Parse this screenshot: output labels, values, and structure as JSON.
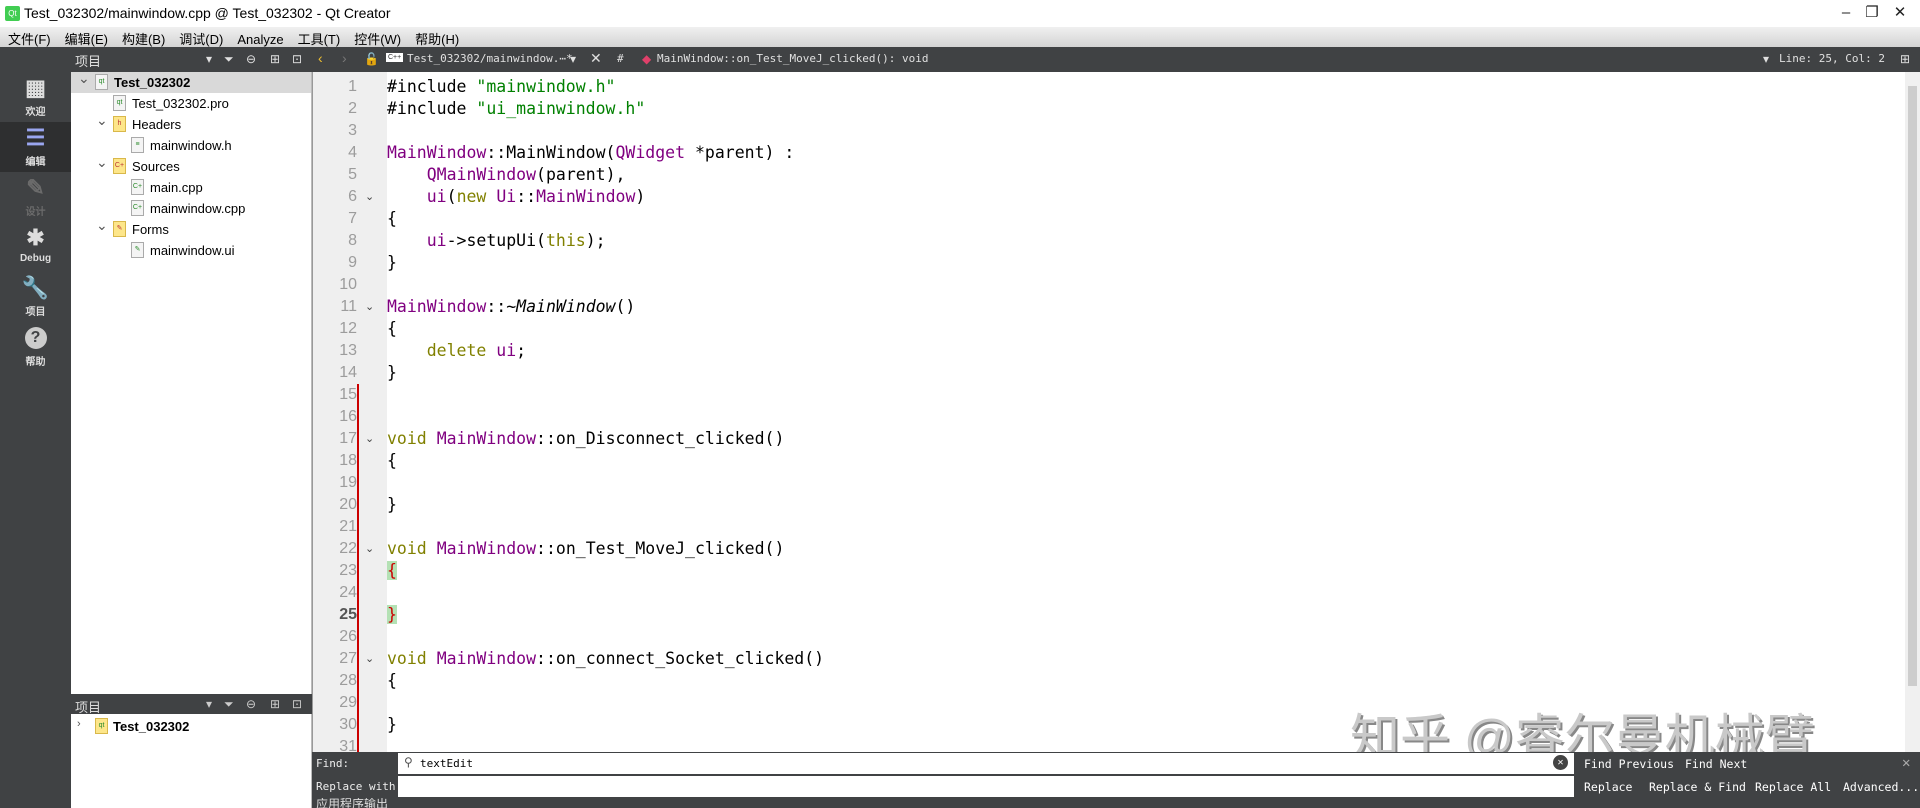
{
  "window": {
    "title": "Test_032302/mainwindow.cpp @ Test_032302 - Qt Creator",
    "app_icon": "Qt",
    "minimize": "–",
    "restore": "❐",
    "close": "✕"
  },
  "menu": [
    "文件(F)",
    "编辑(E)",
    "构建(B)",
    "调试(D)",
    "Analyze",
    "工具(T)",
    "控件(W)",
    "帮助(H)"
  ],
  "toolbar": {
    "panel_title": "项目",
    "file_tab": "Test_032302/mainwindow.⋯*",
    "symbol": "#",
    "function": "MainWindow::on_Test_MoveJ_clicked(): void",
    "position": "Line: 25, Col: 2"
  },
  "modes": [
    {
      "label": "欢迎",
      "icon": "grid-icon"
    },
    {
      "label": "编辑",
      "icon": "edit-icon"
    },
    {
      "label": "设计",
      "icon": "pencil-icon"
    },
    {
      "label": "Debug",
      "icon": "bug-icon"
    },
    {
      "label": "项目",
      "icon": "wrench-icon"
    },
    {
      "label": "帮助",
      "icon": "help-icon"
    }
  ],
  "tree": [
    {
      "label": "Test_032302",
      "depth": 0,
      "bold": true,
      "arrow": "⌄",
      "sel": true,
      "icon": "qt"
    },
    {
      "label": "Test_032302.pro",
      "depth": 1,
      "icon": "qt"
    },
    {
      "label": "Headers",
      "depth": 1,
      "arrow": "⌄",
      "icon": "h",
      "folder": true
    },
    {
      "label": "mainwindow.h",
      "depth": 2,
      "icon": "≡"
    },
    {
      "label": "Sources",
      "depth": 1,
      "arrow": "⌄",
      "icon": "C+",
      "folder": true
    },
    {
      "label": "main.cpp",
      "depth": 2,
      "icon": "C+"
    },
    {
      "label": "mainwindow.cpp",
      "depth": 2,
      "icon": "C+"
    },
    {
      "label": "Forms",
      "depth": 1,
      "arrow": "⌄",
      "icon": "✎",
      "folder": true
    },
    {
      "label": "mainwindow.ui",
      "depth": 2,
      "icon": "✎"
    }
  ],
  "tree2": {
    "panel_title": "项目",
    "root": "Test_032302"
  },
  "code": [
    [
      [
        "#include ",
        ""
      ],
      [
        "\"mainwindow.h\"",
        "s"
      ]
    ],
    [
      [
        "#include ",
        ""
      ],
      [
        "\"ui_mainwindow.h\"",
        "s"
      ]
    ],
    [],
    [
      [
        "MainWindow",
        "ty"
      ],
      [
        "::MainWindow(",
        ""
      ],
      [
        "QWidget",
        "ty"
      ],
      [
        " *parent) :",
        ""
      ]
    ],
    [
      [
        "    ",
        ""
      ],
      [
        "QMainWindow",
        "ty"
      ],
      [
        "(parent),",
        ""
      ]
    ],
    [
      [
        "    ",
        ""
      ],
      [
        "ui",
        "mt"
      ],
      [
        "(",
        ""
      ],
      [
        "new",
        "k"
      ],
      [
        " ",
        ""
      ],
      [
        "Ui",
        "ty"
      ],
      [
        "::",
        ""
      ],
      [
        "MainWindow",
        "ty"
      ],
      [
        ")",
        ""
      ]
    ],
    [
      [
        "{",
        ""
      ]
    ],
    [
      [
        "    ",
        ""
      ],
      [
        "ui",
        "mt"
      ],
      [
        "->setupUi(",
        ""
      ],
      [
        "this",
        "k"
      ],
      [
        ");",
        ""
      ]
    ],
    [
      [
        "}",
        ""
      ]
    ],
    [],
    [
      [
        "MainWindow",
        "ty"
      ],
      [
        "::~",
        ""
      ],
      [
        "MainWindow",
        "it"
      ],
      [
        "()",
        ""
      ]
    ],
    [
      [
        "{",
        ""
      ]
    ],
    [
      [
        "    ",
        ""
      ],
      [
        "delete",
        "k"
      ],
      [
        " ",
        ""
      ],
      [
        "ui",
        "mt"
      ],
      [
        ";",
        ""
      ]
    ],
    [
      [
        "}",
        ""
      ]
    ],
    [],
    [],
    [
      [
        "void",
        "k"
      ],
      [
        " ",
        ""
      ],
      [
        "MainWindow",
        "ty"
      ],
      [
        "::on_Disconnect_clicked()",
        ""
      ]
    ],
    [
      [
        "{",
        ""
      ]
    ],
    [],
    [
      [
        "}",
        ""
      ]
    ],
    [],
    [
      [
        "void",
        "k"
      ],
      [
        " ",
        ""
      ],
      [
        "MainWindow",
        "ty"
      ],
      [
        "::on_Test_MoveJ_clicked()",
        ""
      ]
    ],
    [
      [
        "{",
        "br"
      ]
    ],
    [],
    [
      [
        "}",
        "br"
      ]
    ],
    [],
    [
      [
        "void",
        "k"
      ],
      [
        " ",
        ""
      ],
      [
        "MainWindow",
        "ty"
      ],
      [
        "::on_connect_Socket_clicked()",
        ""
      ]
    ],
    [
      [
        "{",
        ""
      ]
    ],
    [],
    [
      [
        "}",
        ""
      ]
    ],
    []
  ],
  "folds": [
    6,
    11,
    17,
    22,
    27
  ],
  "current_line": 25,
  "find": {
    "find_label": "Find:",
    "replace_label": "Replace with:",
    "find_value": "textEdit",
    "replace_value": "",
    "find_previous": "Find Previous",
    "find_next": "Find Next",
    "replace": "Replace",
    "replace_find": "Replace & Find",
    "replace_all": "Replace All",
    "advanced": "Advanced..."
  },
  "output_label": "应用程序输出",
  "watermark": "知乎 @睿尔曼机械臂"
}
